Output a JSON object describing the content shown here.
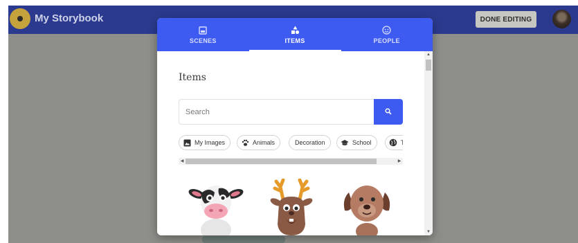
{
  "app": {
    "title": "My Storybook",
    "done_label": "DONE EDITING"
  },
  "modal": {
    "tabs": [
      {
        "label": "SCENES",
        "icon": "image-icon"
      },
      {
        "label": "ITEMS",
        "icon": "shapes-icon"
      },
      {
        "label": "PEOPLE",
        "icon": "face-icon"
      }
    ],
    "active_tab": "ITEMS",
    "section_title": "Items",
    "search": {
      "placeholder": "Search",
      "value": ""
    },
    "chips": [
      {
        "label": "My Images",
        "icon": "image-icon"
      },
      {
        "label": "Animals",
        "icon": "paw-icon"
      },
      {
        "label": "Decoration",
        "icon": ""
      },
      {
        "label": "School",
        "icon": "graduation-cap-icon"
      },
      {
        "label": "T",
        "icon": "globe-icon"
      }
    ],
    "items": [
      {
        "name": "cow"
      },
      {
        "name": "reindeer"
      },
      {
        "name": "dog"
      }
    ]
  },
  "colors": {
    "topbar": "#2b3a8e",
    "accent": "#3d5af1",
    "backdrop": "#8e8e8a"
  }
}
